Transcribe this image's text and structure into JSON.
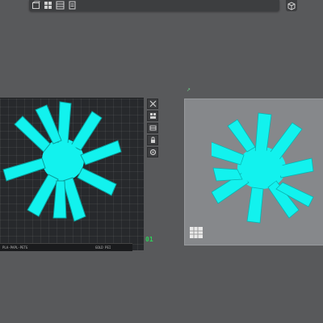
{
  "toolbar": {
    "icons": [
      "cube-icon",
      "grid-icon",
      "layers-icon",
      "document-icon"
    ]
  },
  "plate_tools": [
    "close-icon",
    "arrange-icon",
    "orient-icon",
    "lock-icon",
    "settings-icon"
  ],
  "plate1": {
    "number": "01",
    "label_left": "PLA-PAPL-PETG",
    "label_right": "GOLD PEI"
  },
  "plate2": {
    "corner_marker": "↗"
  },
  "colors": {
    "background": "#58595b",
    "model_fill": "#12f2ee",
    "plate_selected": "#27292c",
    "plate_textured": "#86888b",
    "accent": "#2ed15b"
  }
}
